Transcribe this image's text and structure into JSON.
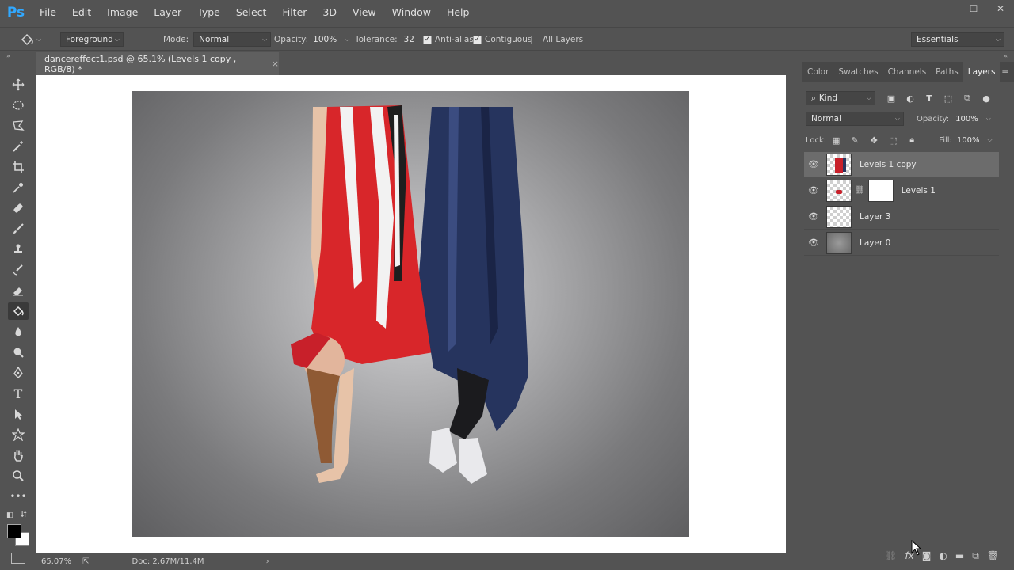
{
  "app": {
    "logo": "Ps"
  },
  "menu": [
    "File",
    "Edit",
    "Image",
    "Layer",
    "Type",
    "Select",
    "Filter",
    "3D",
    "View",
    "Window",
    "Help"
  ],
  "window_controls": {
    "minimize": "—",
    "maximize": "☐",
    "close": "✕"
  },
  "options": {
    "fill_source": "Foreground",
    "mode_label": "Mode:",
    "mode_value": "Normal",
    "opacity_label": "Opacity:",
    "opacity_value": "100%",
    "tolerance_label": "Tolerance:",
    "tolerance_value": "32",
    "antialias_label": "Anti-alias",
    "contiguous_label": "Contiguous",
    "all_layers_label": "All Layers",
    "workspace": "Essentials"
  },
  "document": {
    "tab_title": "dancereffect1.psd @ 65.1% (Levels 1 copy , RGB/8) *",
    "close": "×"
  },
  "status": {
    "zoom": "65.07%",
    "doc": "Doc: 2.67M/11.4M"
  },
  "panels": {
    "tabs": [
      "Color",
      "Swatches",
      "Channels",
      "Paths",
      "Layers"
    ],
    "filter_kind": "Kind",
    "blend_mode": "Normal",
    "opacity_label": "Opacity:",
    "opacity_value": "100%",
    "lock_label": "Lock:",
    "fill_label": "Fill:",
    "fill_value": "100%"
  },
  "layers": [
    {
      "name": "Levels 1 copy",
      "selected": true
    },
    {
      "name": "Levels 1",
      "selected": false
    },
    {
      "name": "Layer 3",
      "selected": false
    },
    {
      "name": "Layer 0",
      "selected": false
    }
  ]
}
